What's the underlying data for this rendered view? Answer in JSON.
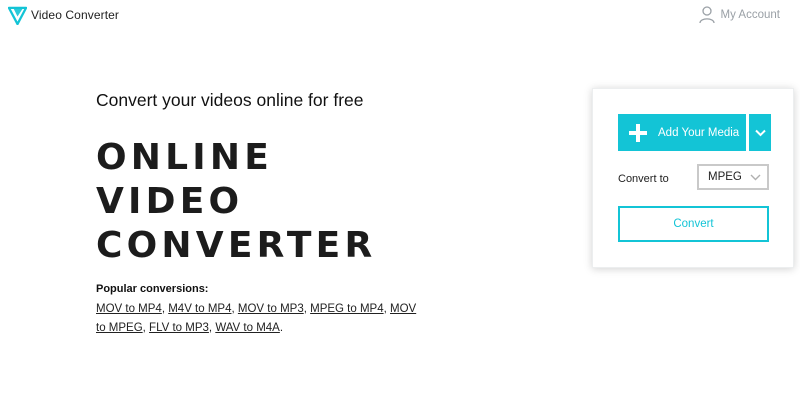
{
  "header": {
    "app_title": "Video Converter",
    "logo_icon": "v-logo-icon",
    "account_icon": "user-icon",
    "account_label": "My Account"
  },
  "hero": {
    "subtitle": "Convert your videos online for free",
    "title_lines": [
      "ONLINE",
      "VIDEO",
      "CONVERTER"
    ]
  },
  "popular": {
    "label": "Popular conversions:",
    "links": [
      "MOV to MP4",
      "M4V to MP4",
      "MOV to MP3",
      "MPEG to MP4",
      "MOV to MPEG",
      "FLV to MP3",
      "WAV to M4A"
    ]
  },
  "panel": {
    "add_media_label": "Add Your Media",
    "add_media_icon": "plus-icon",
    "dropdown_icon": "chevron-down-icon",
    "convert_to_label": "Convert to",
    "format_value": "MPEG",
    "convert_label": "Convert"
  },
  "colors": {
    "accent": "#13c4d6",
    "text": "#1a1a1a",
    "muted": "#9aa0a6"
  }
}
